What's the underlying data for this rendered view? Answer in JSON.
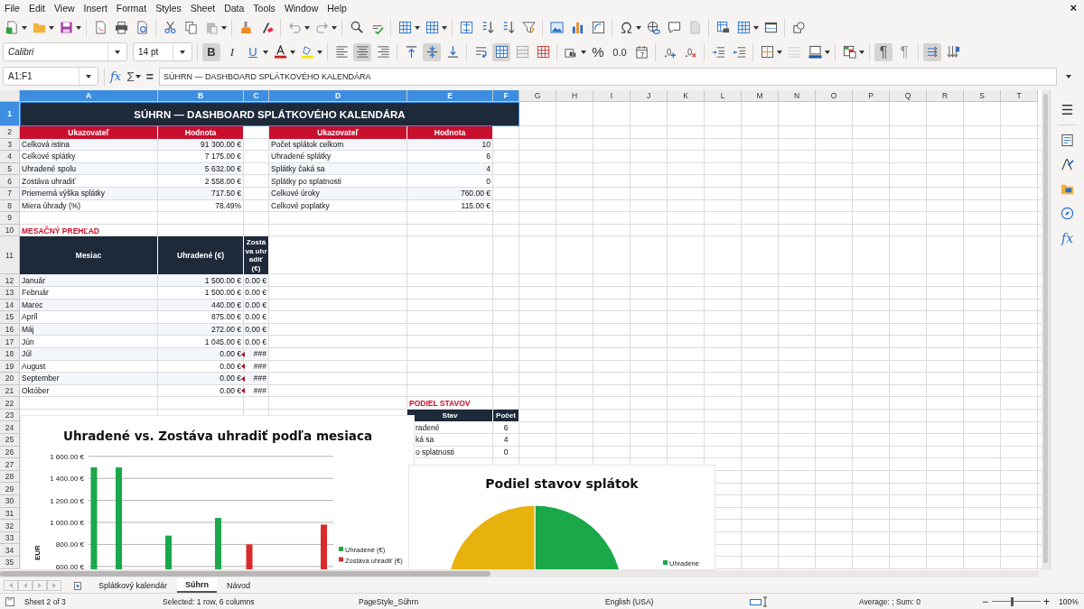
{
  "menu_bar": {
    "items": [
      "File",
      "Edit",
      "View",
      "Insert",
      "Format",
      "Styles",
      "Sheet",
      "Data",
      "Tools",
      "Window",
      "Help"
    ],
    "close": "×"
  },
  "format_toolbar": {
    "font": "Calibri",
    "size": "14 pt",
    "bold": {
      "glyph": "B",
      "on": true
    },
    "italic": {
      "glyph": "I",
      "on": false
    },
    "underline": {
      "glyph": "U",
      "on": false
    },
    "align": [
      {
        "selected": false
      },
      {
        "selected": true
      },
      {
        "selected": false
      }
    ],
    "valign": [
      {
        "selected": false
      },
      {
        "selected": true
      },
      {
        "selected": false
      }
    ],
    "merge": [
      {
        "on": true
      },
      {
        "on": false
      },
      {
        "on": false
      }
    ],
    "percent": "%",
    "decimal": "0.0",
    "direction": [
      {
        "glyph": "¶",
        "selected": true
      },
      {
        "glyph": "¶",
        "selected": false
      }
    ],
    "text_flow": [
      {
        "selected": true
      },
      {
        "selected": false
      }
    ]
  },
  "formula_bar": {
    "name_box": "A1:F1",
    "function_wizard": "fx",
    "sum": "Σ",
    "equals": "=",
    "formula": "SÚHRN — DASHBOARD SPLÁTKOVÉHO KALENDÁRA"
  },
  "columns": [
    {
      "label": "A",
      "selected": true
    },
    {
      "label": "B",
      "selected": true
    },
    {
      "label": "C",
      "selected": true
    },
    {
      "label": "D",
      "selected": true
    },
    {
      "label": "E",
      "selected": true
    },
    {
      "label": "F",
      "selected": true
    },
    {
      "label": "G",
      "selected": false
    },
    {
      "label": "H",
      "selected": false
    },
    {
      "label": "I",
      "selected": false
    },
    {
      "label": "J",
      "selected": false
    },
    {
      "label": "K",
      "selected": false
    },
    {
      "label": "L",
      "selected": false
    },
    {
      "label": "M",
      "selected": false
    },
    {
      "label": "N",
      "selected": false
    },
    {
      "label": "O",
      "selected": false
    },
    {
      "label": "P",
      "selected": false
    },
    {
      "label": "Q",
      "selected": false
    },
    {
      "label": "R",
      "selected": false
    },
    {
      "label": "S",
      "selected": false
    },
    {
      "label": "T",
      "selected": false
    }
  ],
  "rows": [
    {
      "label": "1",
      "selected": true
    },
    {
      "label": "2",
      "selected": false
    },
    {
      "label": "3",
      "selected": false
    },
    {
      "label": "4",
      "selected": false
    },
    {
      "label": "5",
      "selected": false
    },
    {
      "label": "6",
      "selected": false
    },
    {
      "label": "7",
      "selected": false
    },
    {
      "label": "8",
      "selected": false
    },
    {
      "label": "9",
      "selected": false
    },
    {
      "label": "10",
      "selected": false
    },
    {
      "label": "11",
      "selected": false
    },
    {
      "label": "12",
      "selected": false
    },
    {
      "label": "13",
      "selected": false
    },
    {
      "label": "14",
      "selected": false
    },
    {
      "label": "15",
      "selected": false
    },
    {
      "label": "16",
      "selected": false
    },
    {
      "label": "17",
      "selected": false
    },
    {
      "label": "18",
      "selected": false
    },
    {
      "label": "19",
      "selected": false
    },
    {
      "label": "20",
      "selected": false
    },
    {
      "label": "21",
      "selected": false
    },
    {
      "label": "22",
      "selected": false
    },
    {
      "label": "23",
      "selected": false
    },
    {
      "label": "24",
      "selected": false
    },
    {
      "label": "25",
      "selected": false
    },
    {
      "label": "26",
      "selected": false
    },
    {
      "label": "27",
      "selected": false
    },
    {
      "label": "28",
      "selected": false
    },
    {
      "label": "29",
      "selected": false
    },
    {
      "label": "30",
      "selected": false
    },
    {
      "label": "31",
      "selected": false
    },
    {
      "label": "32",
      "selected": false
    },
    {
      "label": "33",
      "selected": false
    },
    {
      "label": "34",
      "selected": false
    },
    {
      "label": "35",
      "selected": false
    }
  ],
  "title_cell": "SÚHRN — DASHBOARD SPLÁTKOVÉHO KALENDÁRA",
  "summary_left": {
    "headers": [
      "Ukazovateľ",
      "Hodnota"
    ],
    "rows": [
      {
        "label": "Celková istina",
        "value": "91 300.00 €"
      },
      {
        "label": "Celkové splátky",
        "value": "7 175.00 €"
      },
      {
        "label": "Uhradené spolu",
        "value": "5 632.00 €"
      },
      {
        "label": "Zostáva uhradiť",
        "value": "2 558.00 €"
      },
      {
        "label": "Priemerná výška splátky",
        "value": "717.50 €"
      },
      {
        "label": "Miera úhrady (%)",
        "value": "78.49%"
      }
    ]
  },
  "summary_right": {
    "headers": [
      "Ukazovateľ",
      "Hodnota"
    ],
    "rows": [
      {
        "label": "Počet splátok celkom",
        "value": "10"
      },
      {
        "label": "Uhradené splátky",
        "value": "6"
      },
      {
        "label": "Splátky čaká sa",
        "value": "4"
      },
      {
        "label": "Splátky po splatnosti",
        "value": "0"
      },
      {
        "label": "Celkové úroky",
        "value": "760.00 €"
      },
      {
        "label": "Celkové poplatky",
        "value": "115.00 €"
      }
    ]
  },
  "monthly": {
    "title": "MESAČNÝ PREHĽAD",
    "headers": [
      "Mesiac",
      "Uhradené (€)",
      "Zostáva uhradiť (€)"
    ],
    "rows": [
      {
        "month": "Január",
        "paid": "1 500.00 €",
        "remaining": "0.00 €",
        "overflow": false
      },
      {
        "month": "Február",
        "paid": "1 500.00 €",
        "remaining": "0.00 €",
        "overflow": false
      },
      {
        "month": "Marec",
        "paid": "440.00 €",
        "remaining": "0.00 €",
        "overflow": false
      },
      {
        "month": "Apríl",
        "paid": "875.00 €",
        "remaining": "0.00 €",
        "overflow": false
      },
      {
        "month": "Máj",
        "paid": "272.00 €",
        "remaining": "0.00 €",
        "overflow": false
      },
      {
        "month": "Jún",
        "paid": "1 045.00 €",
        "remaining": "0.00 €",
        "overflow": false
      },
      {
        "month": "Júl",
        "paid": "0.00 €",
        "remaining": "###",
        "overflow": true
      },
      {
        "month": "August",
        "paid": "0.00 €",
        "remaining": "###",
        "overflow": true
      },
      {
        "month": "September",
        "paid": "0.00 €",
        "remaining": "###",
        "overflow": true
      },
      {
        "month": "Október",
        "paid": "0.00 €",
        "remaining": "###",
        "overflow": true
      }
    ]
  },
  "status_share": {
    "title": "PODIEL STAVOV",
    "headers": [
      "Stav",
      "Počet"
    ],
    "rows": [
      {
        "label": "radené",
        "count": "6"
      },
      {
        "label": "ká sa",
        "count": "4"
      },
      {
        "label": "o splatnosti",
        "count": "0"
      }
    ]
  },
  "bar_chart": {
    "chart_data": {
      "type": "bar",
      "title": "Uhradené vs. Zostáva uhradiť podľa mesiaca",
      "ylabel": "EUR",
      "ylim": [
        600,
        1600
      ],
      "grid": true,
      "legend": true,
      "yticks": [
        {
          "value": 600,
          "label": "600.00 €"
        },
        {
          "value": 800,
          "label": "800.00 €"
        },
        {
          "value": 1000,
          "label": "1 000.00 €"
        },
        {
          "value": 1200,
          "label": "1 200.00 €"
        },
        {
          "value": 1400,
          "label": "1 400.00 €"
        },
        {
          "value": 1600,
          "label": "1 600.00 €"
        }
      ],
      "series": [
        {
          "name": "Uhradené (€)",
          "color": "#1aa84a",
          "values": [
            1500,
            1500,
            null,
            880,
            null,
            1040,
            null,
            null,
            null,
            null
          ]
        },
        {
          "name": "Zostáva uhradiť (€)",
          "color": "#d92b2b",
          "values": [
            null,
            null,
            null,
            null,
            null,
            null,
            800,
            null,
            null,
            980
          ]
        }
      ]
    }
  },
  "pie_chart": {
    "chart_data": {
      "type": "pie",
      "title": "Podiel stavov splátok",
      "values": [
        60,
        40,
        0
      ]
    },
    "legend_label": "Uhradené"
  },
  "sheet_tabs": [
    {
      "label": "Splátkový kalendár",
      "selected": false
    },
    {
      "label": "Súhrn",
      "selected": true
    },
    {
      "label": "Návod",
      "selected": false
    }
  ],
  "status_bar": {
    "sheet": "Sheet 2 of 3",
    "selection": "Selected: 1 row, 6 columns",
    "page_style": "PageStyle_Súhrn",
    "language": "English (USA)",
    "sum": "Average: ; Sum: 0",
    "zoom_out": "−",
    "zoom_in": "+",
    "zoom": {
      "level": 0.4
    },
    "zoom_label": "100%"
  },
  "sidebar": {
    "functions": "fx"
  }
}
